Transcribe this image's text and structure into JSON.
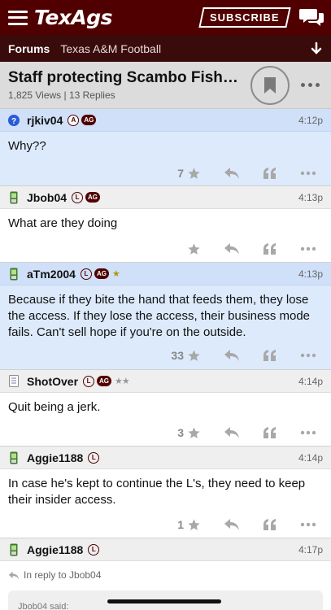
{
  "header": {
    "logo": "TexAgs",
    "subscribe_label": "SUBSCRIBE",
    "brand_color": "#500000"
  },
  "breadcrumb": {
    "forums": "Forums",
    "subforum": "Texas A&M Football"
  },
  "thread": {
    "title": "Staff protecting Scambo Fisher...",
    "meta": "1,825 Views | 13 Replies"
  },
  "posts": [
    {
      "user": "rjkiv04",
      "icon": "question-icon",
      "time": "4:12p",
      "text": "Why??",
      "likes": "7",
      "highlight": true
    },
    {
      "user": "Jbob04",
      "icon": "phone-icon",
      "time": "4:13p",
      "text": "What are they doing",
      "likes": "",
      "highlight": false
    },
    {
      "user": "aTm2004",
      "icon": "phone-icon",
      "time": "4:13p",
      "text": "Because if they bite the hand that feeds them, they lose the access. If they lose the access, their business mode fails. Can't sell hope if you're on the outside.",
      "likes": "33",
      "highlight": true
    },
    {
      "user": "ShotOver",
      "icon": "document-icon",
      "time": "4:14p",
      "text": "Quit being a jerk.",
      "likes": "3",
      "highlight": false
    },
    {
      "user": "Aggie1188",
      "icon": "phone-icon",
      "time": "4:14p",
      "text": "In case he's kept to continue the L's, they need to keep their insider access.",
      "likes": "1",
      "highlight": false
    },
    {
      "user": "Aggie1188",
      "icon": "phone-icon",
      "time": "4:17p",
      "reply_to": "In reply to Jbob04",
      "quote_author": "Jbob04 said:",
      "highlight": false
    }
  ]
}
